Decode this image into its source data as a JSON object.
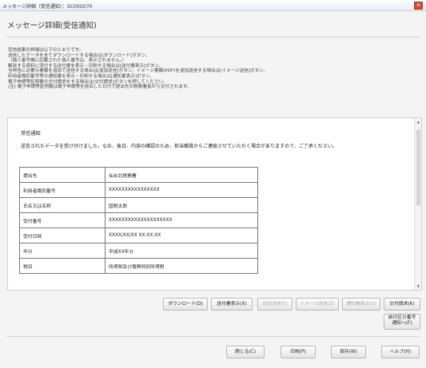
{
  "window": {
    "title": "メッセージ詳細（受信通知）：SC00G070",
    "close_glyph": "✕"
  },
  "page": {
    "heading": "メッセージ詳細(受信通知)"
  },
  "info_lines": [
    "受信結果の詳細は以下のとおりです。",
    "送信したデータを全てダウンロードする場合は[ダウンロード]ボタン、",
    "（個人番号欄に記載された個人番号は、表示されません。）",
    "郵送する資料に添付する送付書を表示・印刷する場合は[送付書表示]ボタン、",
    "当申告に必要な書類を追加で送信する場合は[追加送信]ボタン、イメージ書類(PDF)を追加送信する場合は[イメージ送信]ボタン、",
    "利用者識別番号等の通知書を表示・印刷する場合は[通知書表示]ボタン、",
    "電子申請等証明書の交付請求をする場合は[交付請求]ボタンを押してください。",
    "(注) 電子申請等証明書は電子申請等を提出した日付で提出先の税務署長から交付されます。"
  ],
  "notice": {
    "title": "受信通知",
    "text": "送信されたデータを受け付けました。なお、後日、内容の確認のため、担当職員からご連絡させていただく場合がありますので、ご了承ください。",
    "rows": [
      {
        "label": "提出先",
        "value": "仙台北税務署"
      },
      {
        "label": "利用者識別番号",
        "value": "XXXXXXXXXXXXXXXX"
      },
      {
        "label": "氏名又は名称",
        "value": "国税太郎"
      },
      {
        "label": "受付番号",
        "value": "XXXXXXXXXXXXXXXXXXXX"
      },
      {
        "label": "受付日時",
        "value": "XXXX/XX/XX XX:XX:XX"
      },
      {
        "label": "年分",
        "value": "平成XX年分"
      },
      {
        "label": "税目",
        "value": "所得税及び復興特別所得税"
      }
    ]
  },
  "actions": {
    "download": "ダウンロード(D)",
    "send_doc": "送付書表示(X)",
    "add_send": "追加送信(Y)",
    "image_send": "イメージ送信(Z)",
    "notice_doc": "通知書表示(U)",
    "issue_request": "交付請求(K)",
    "tax_office_1": "納付区分番号",
    "tax_office_2": "通知へ(F)"
  },
  "footer": {
    "close": "閉じる(C)",
    "print": "印刷(P)",
    "save": "保存(W)",
    "help": "ヘルプ(H)"
  }
}
